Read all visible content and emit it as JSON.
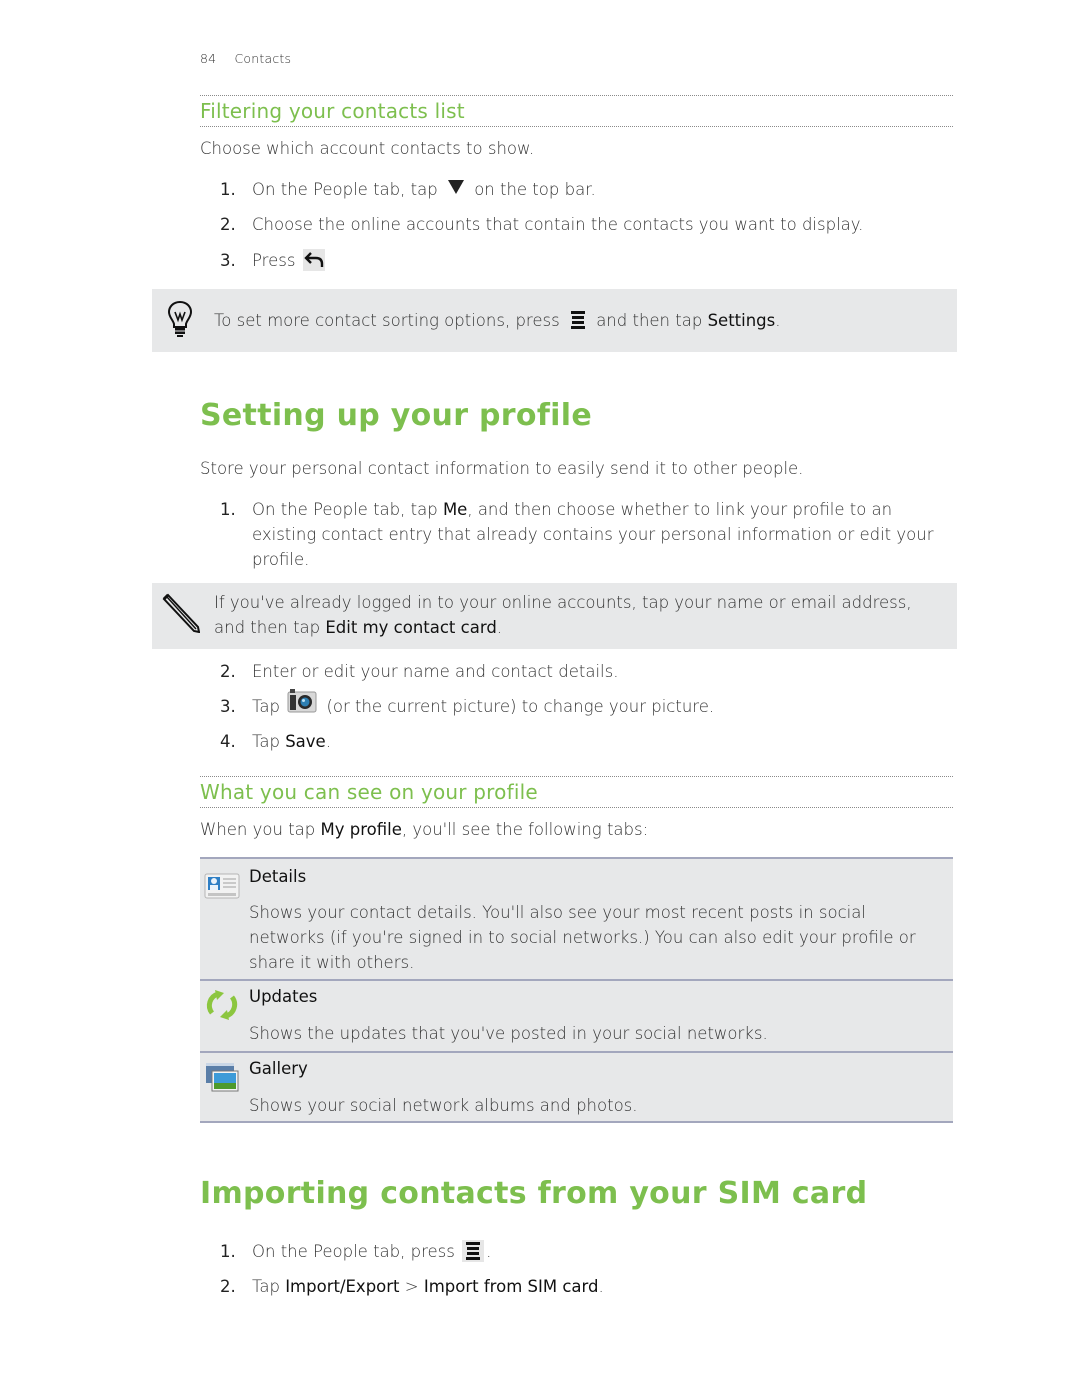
{
  "header": {
    "page_number": "84",
    "section": "Contacts"
  },
  "filtering": {
    "title": "Filtering your contacts list",
    "intro": "Choose which account contacts to show.",
    "steps": [
      {
        "num": "1.",
        "before": "On the People tab, tap",
        "icon": "triangle-down-icon",
        "after": "on the top bar."
      },
      {
        "num": "2.",
        "text": "Choose the online accounts that contain the contacts you want to display."
      },
      {
        "num": "3.",
        "before": "Press",
        "icon": "back-icon"
      }
    ],
    "tip": {
      "icon": "lightbulb-icon",
      "before": "To set more contact sorting options, press",
      "menu_icon": "menu-icon",
      "middle": "and then tap",
      "bold": "Settings",
      "after": "."
    }
  },
  "profile": {
    "title": "Setting up your profile",
    "intro": "Store your personal contact information to easily send it to other people.",
    "step1": {
      "num": "1.",
      "before": "On the People tab, tap",
      "bold": "Me",
      "after": ", and then choose whether to link your profile to an existing contact entry that already contains your personal information or edit your profile."
    },
    "note": {
      "icon": "pencil-icon",
      "before": "If you've already logged in to your online accounts, tap your name or email address, and then tap",
      "bold": "Edit my contact card",
      "after": "."
    },
    "step2": {
      "num": "2.",
      "text": "Enter or edit your name and contact details."
    },
    "step3": {
      "num": "3.",
      "before": "Tap",
      "icon": "camera-icon",
      "after": "(or the current picture) to change your picture."
    },
    "step4": {
      "num": "4.",
      "before": "Tap",
      "bold": "Save",
      "after": "."
    }
  },
  "what_you_see": {
    "title": "What you can see on your profile",
    "intro_before": "When you tap",
    "intro_bold": "My profile",
    "intro_after": ", you'll see the following tabs:",
    "tabs": [
      {
        "icon": "contact-card-icon",
        "title": "Details",
        "desc": "Shows your contact details. You'll also see your most recent posts in social networks (if you're signed in to social networks.) You can also edit your profile or share it with others."
      },
      {
        "icon": "refresh-icon",
        "title": "Updates",
        "desc": "Shows the updates that you've posted in your social networks."
      },
      {
        "icon": "gallery-icon",
        "title": "Gallery",
        "desc": "Shows your social network albums and photos."
      }
    ]
  },
  "sim": {
    "title": "Importing contacts from your SIM card",
    "step1": {
      "num": "1.",
      "before": "On the People tab, press",
      "icon": "menu-icon",
      "after": "."
    },
    "step2": {
      "num": "2.",
      "before": "Tap",
      "bold1": "Import/Export",
      "sep": " > ",
      "bold2": "Import from SIM card",
      "after": "."
    }
  }
}
